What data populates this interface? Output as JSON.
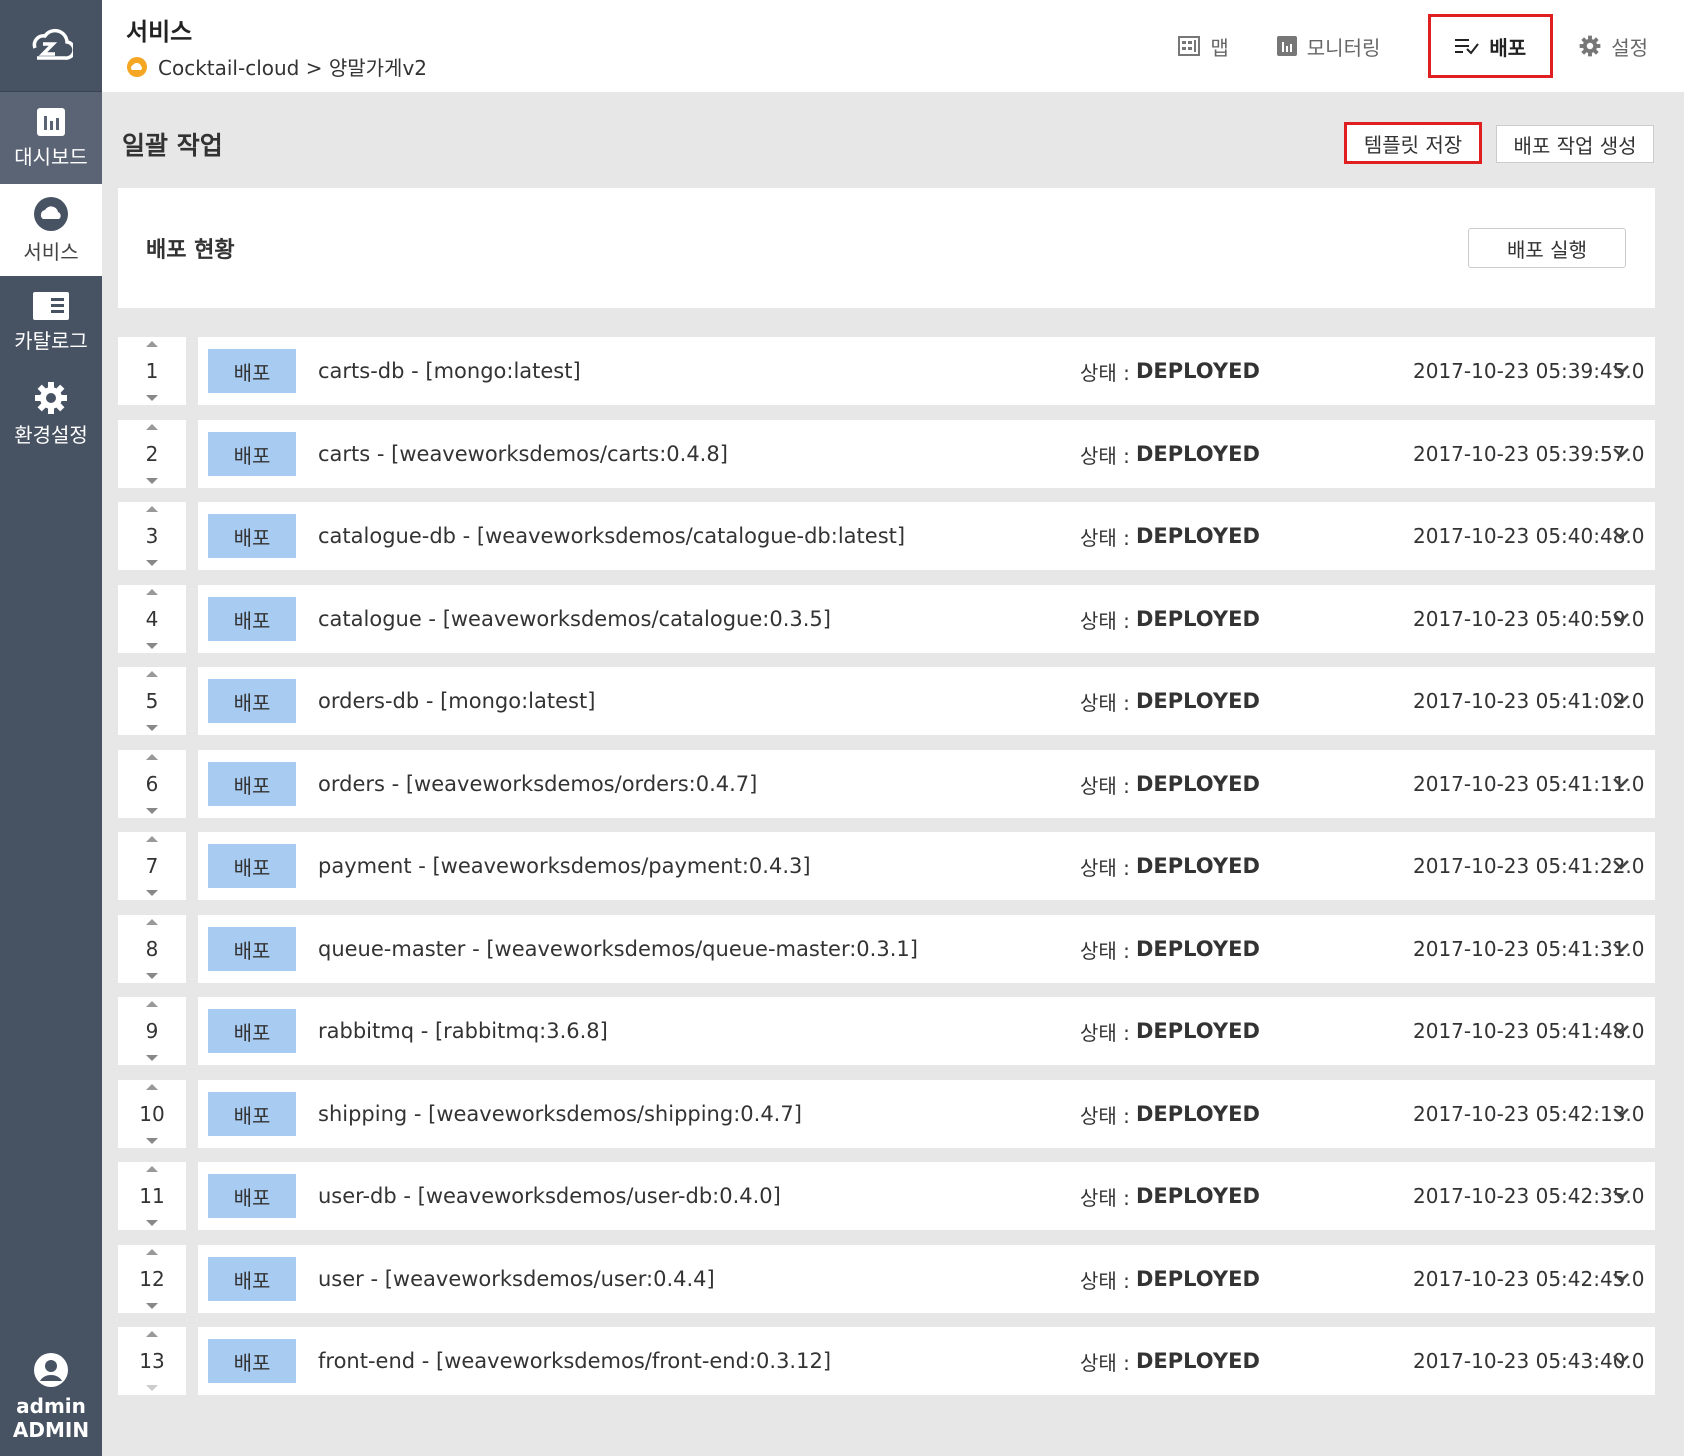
{
  "sidebar": {
    "items": [
      {
        "label": "대시보드",
        "icon": "bar-chart-icon"
      },
      {
        "label": "서비스",
        "icon": "cloud-icon"
      },
      {
        "label": "카탈로그",
        "icon": "catalog-icon"
      },
      {
        "label": "환경설정",
        "icon": "gear-icon"
      }
    ],
    "user": {
      "name": "admin",
      "role": "ADMIN"
    }
  },
  "header": {
    "title": "서비스",
    "breadcrumb": "Cocktail-cloud > 양말가게v2",
    "tabs": [
      {
        "label": "맵",
        "icon": "map-icon"
      },
      {
        "label": "모니터링",
        "icon": "monitoring-icon"
      },
      {
        "label": "배포",
        "icon": "deploy-icon"
      },
      {
        "label": "설정",
        "icon": "gear-icon"
      }
    ]
  },
  "main": {
    "section_title": "일괄 작업",
    "template_save_label": "템플릿 저장",
    "create_job_label": "배포 작업 생성",
    "status_title": "배포 현황",
    "run_label": "배포 실행",
    "state_prefix": "상태 :",
    "badge_label": "배포",
    "rows": [
      {
        "num": "1",
        "service": "carts-db - [mongo:latest]",
        "state": "DEPLOYED",
        "time": "2017-10-23 05:39:45.0"
      },
      {
        "num": "2",
        "service": "carts - [weaveworksdemos/carts:0.4.8]",
        "state": "DEPLOYED",
        "time": "2017-10-23 05:39:57.0"
      },
      {
        "num": "3",
        "service": "catalogue-db - [weaveworksdemos/catalogue-db:latest]",
        "state": "DEPLOYED",
        "time": "2017-10-23 05:40:48.0"
      },
      {
        "num": "4",
        "service": "catalogue - [weaveworksdemos/catalogue:0.3.5]",
        "state": "DEPLOYED",
        "time": "2017-10-23 05:40:59.0"
      },
      {
        "num": "5",
        "service": "orders-db - [mongo:latest]",
        "state": "DEPLOYED",
        "time": "2017-10-23 05:41:02.0"
      },
      {
        "num": "6",
        "service": "orders - [weaveworksdemos/orders:0.4.7]",
        "state": "DEPLOYED",
        "time": "2017-10-23 05:41:11.0"
      },
      {
        "num": "7",
        "service": "payment - [weaveworksdemos/payment:0.4.3]",
        "state": "DEPLOYED",
        "time": "2017-10-23 05:41:22.0"
      },
      {
        "num": "8",
        "service": "queue-master - [weaveworksdemos/queue-master:0.3.1]",
        "state": "DEPLOYED",
        "time": "2017-10-23 05:41:31.0"
      },
      {
        "num": "9",
        "service": "rabbitmq - [rabbitmq:3.6.8]",
        "state": "DEPLOYED",
        "time": "2017-10-23 05:41:48.0"
      },
      {
        "num": "10",
        "service": "shipping - [weaveworksdemos/shipping:0.4.7]",
        "state": "DEPLOYED",
        "time": "2017-10-23 05:42:13.0"
      },
      {
        "num": "11",
        "service": "user-db - [weaveworksdemos/user-db:0.4.0]",
        "state": "DEPLOYED",
        "time": "2017-10-23 05:42:35.0"
      },
      {
        "num": "12",
        "service": "user - [weaveworksdemos/user:0.4.4]",
        "state": "DEPLOYED",
        "time": "2017-10-23 05:42:45.0"
      },
      {
        "num": "13",
        "service": "front-end - [weaveworksdemos/front-end:0.3.12]",
        "state": "DEPLOYED",
        "time": "2017-10-23 05:43:40.0"
      }
    ]
  },
  "colors": {
    "sidebar": "#475263",
    "badge": "#a8cbf2",
    "highlight": "#e02020",
    "accent": "#f5a623"
  }
}
